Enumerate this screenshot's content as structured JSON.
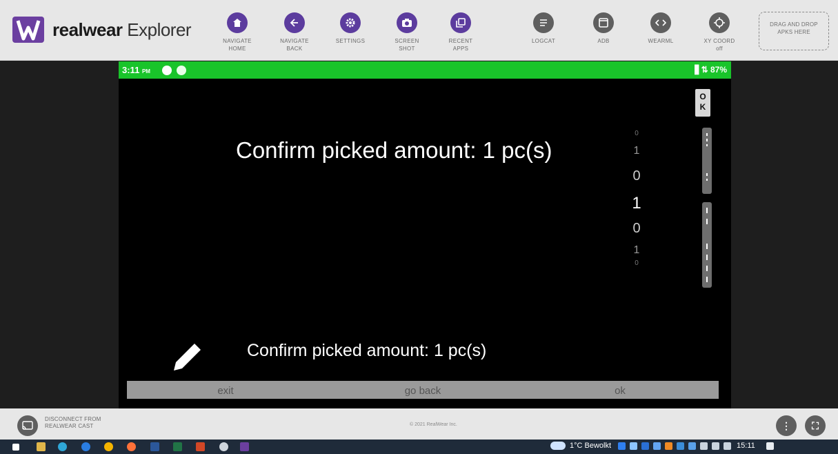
{
  "app": {
    "brand_bold": "realwear",
    "brand_light": "Explorer"
  },
  "toolbar": {
    "items": [
      {
        "id": "home",
        "line1": "NAVIGATE",
        "line2": "HOME",
        "icon": "home-icon"
      },
      {
        "id": "back",
        "line1": "NAVIGATE",
        "line2": "BACK",
        "icon": "arrow-left-icon"
      },
      {
        "id": "settings",
        "line1": "SETTINGS",
        "line2": "",
        "icon": "gear-icon"
      },
      {
        "id": "screenshot",
        "line1": "SCREEN",
        "line2": "SHOT",
        "icon": "camera-icon"
      },
      {
        "id": "recent",
        "line1": "RECENT",
        "line2": "APPS",
        "icon": "recent-apps-icon"
      },
      {
        "id": "logcat",
        "line1": "LOGCAT",
        "line2": "",
        "icon": "menu-lines-icon"
      },
      {
        "id": "adb",
        "line1": "ADB",
        "line2": "",
        "icon": "window-icon"
      },
      {
        "id": "wearml",
        "line1": "WEARML",
        "line2": "",
        "icon": "code-icon"
      },
      {
        "id": "xycoord",
        "line1": "XY COORD",
        "line2": "off",
        "icon": "crosshair-icon"
      }
    ],
    "dropzone_line1": "DRAG AND DROP",
    "dropzone_line2": "APKS HERE"
  },
  "device": {
    "status_time": "3:11",
    "status_ampm": "PM",
    "status_right": "▋⇅ 87%",
    "battery": "87%",
    "prompt": "Confirm picked amount: 1 pc(s)",
    "picker_values": [
      "0",
      "1",
      "0",
      "1",
      "0",
      "1",
      "0"
    ],
    "ok_label_1": "O",
    "ok_label_2": "K",
    "sub_prompt": "Confirm picked amount: 1 pc(s)",
    "actions": [
      "exit",
      "go back",
      "ok"
    ]
  },
  "bottom": {
    "cast_line1": "DISCONNECT FROM",
    "cast_line2": "REALWEAR CAST",
    "copyright": "© 2021 RealWear Inc.",
    "more_glyph": "⋮",
    "fullscreen_glyph": "⛶"
  },
  "taskbar": {
    "weather": "1°C  Bewolkt",
    "time": "15:11"
  },
  "colors": {
    "accent_purple": "#5c3c9e",
    "status_green": "#19c42a"
  }
}
